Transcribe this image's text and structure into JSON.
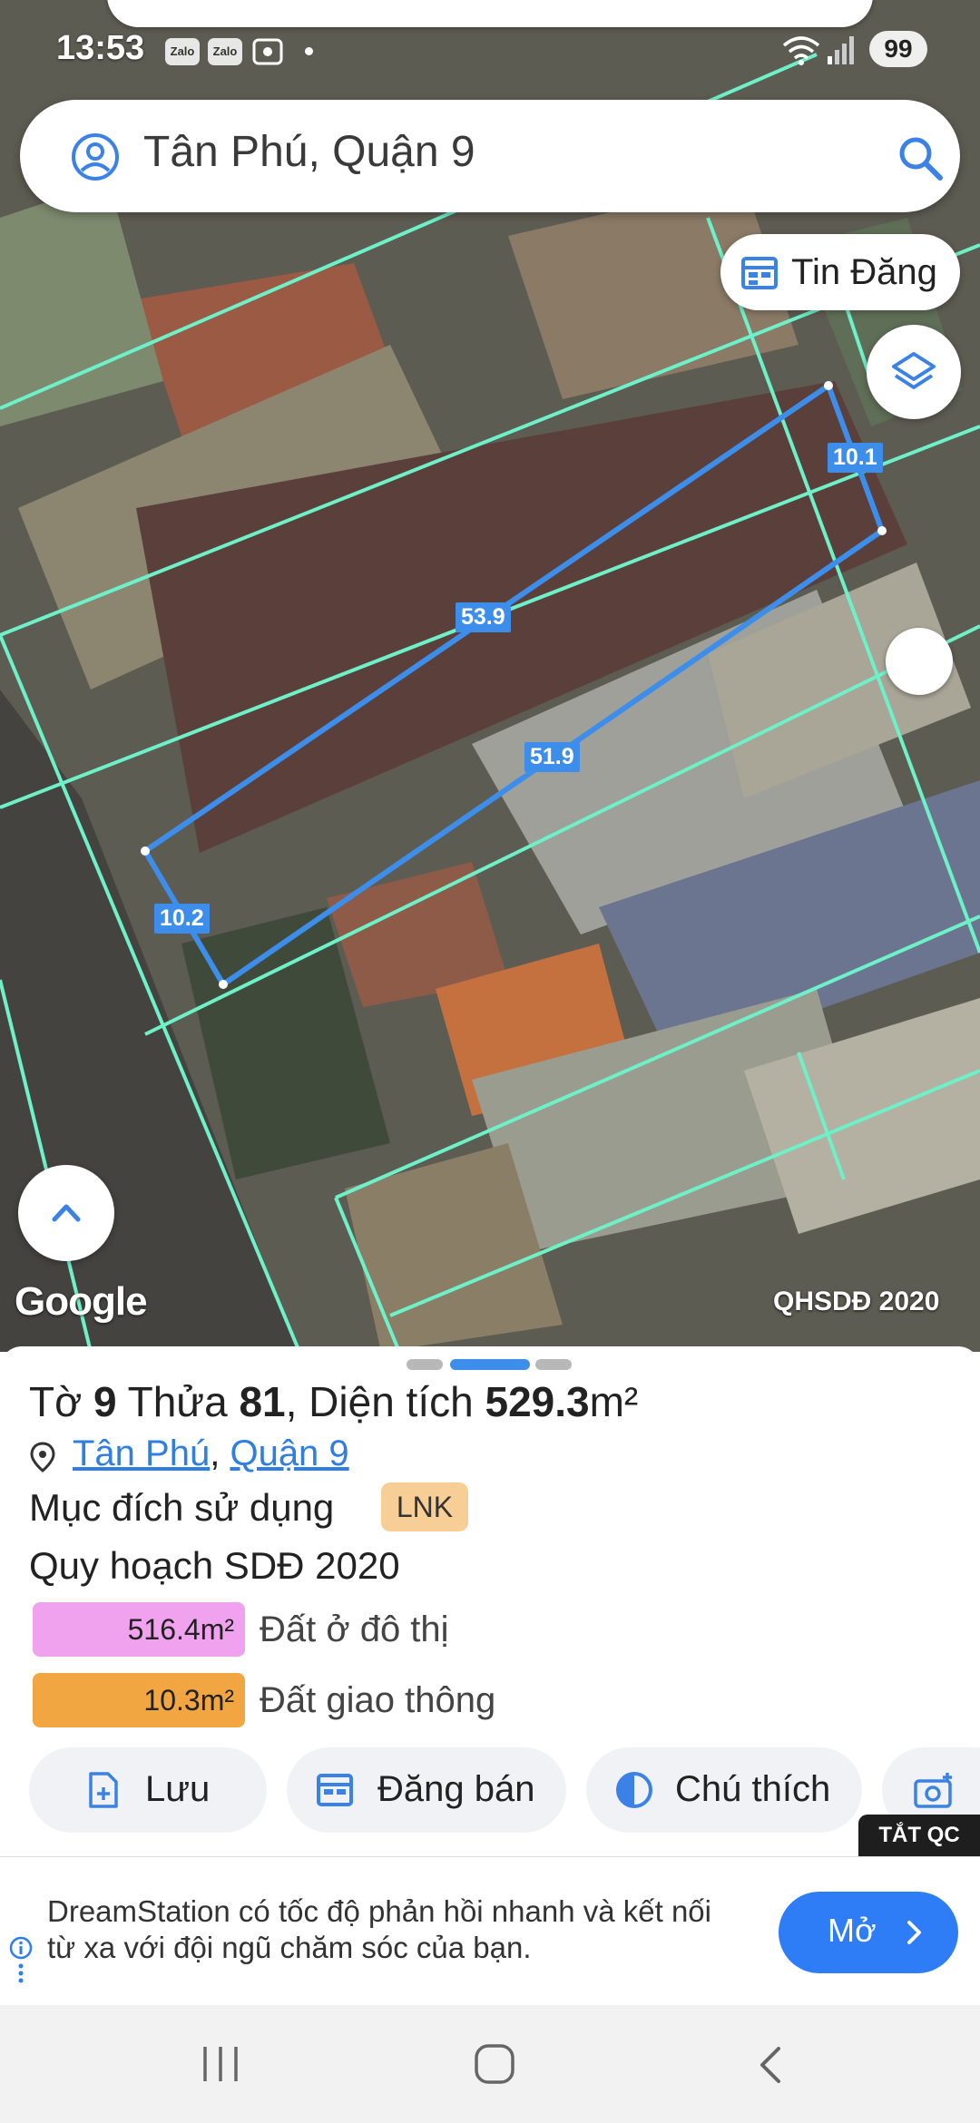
{
  "status_bar": {
    "time": "13:53",
    "apps": [
      "Zalo",
      "Zalo"
    ],
    "icons": [
      "zalo-icon",
      "zalo-icon",
      "screenshot-icon",
      "wifi-icon",
      "signal-icon"
    ],
    "battery": "99"
  },
  "search": {
    "value": "Tân Phú, Quận 9",
    "icons": [
      "account-icon",
      "search-icon"
    ]
  },
  "map": {
    "tin_dang_label": "Tin Đăng",
    "dimensions": [
      "10.1",
      "53.9",
      "51.9",
      "10.2"
    ],
    "google_label": "Google",
    "layer_label": "QHSDĐ 2020",
    "parcel_outline_color": "#3d8eea",
    "boundary_color": "#6ef0c8"
  },
  "parcel": {
    "sheet_prefix": "Tờ",
    "sheet": "9",
    "plot_prefix": "Thửa",
    "plot": "81",
    "area_prefix": ", Diện tích",
    "area": "529.3",
    "area_unit": "m²",
    "ward": "Tân Phú",
    "district": "Quận 9",
    "purpose_label": "Mục đích sử dụng",
    "purpose_code": "LNK",
    "plan_title": "Quy hoạch SDĐ 2020",
    "plan_items": [
      {
        "area": "516.4m²",
        "label": "Đất ở đô thị",
        "color": "#f0a2ee"
      },
      {
        "area": "10.3m²",
        "label": "Đất giao thông",
        "color": "#f2a641"
      }
    ]
  },
  "actions": [
    {
      "label": "Lưu",
      "icon": "file-plus-icon"
    },
    {
      "label": "Đăng bán",
      "icon": "calendar-icon"
    },
    {
      "label": "Chú thích",
      "icon": "contrast-icon"
    },
    {
      "label": "",
      "icon": "camera-plus-icon"
    }
  ],
  "ad": {
    "close_label": "TẮT QC",
    "text": "DreamStation có tốc độ phản hồi nhanh và kết nối từ xa với đội ngũ chăm sóc của bạn.",
    "button_label": "Mở"
  }
}
